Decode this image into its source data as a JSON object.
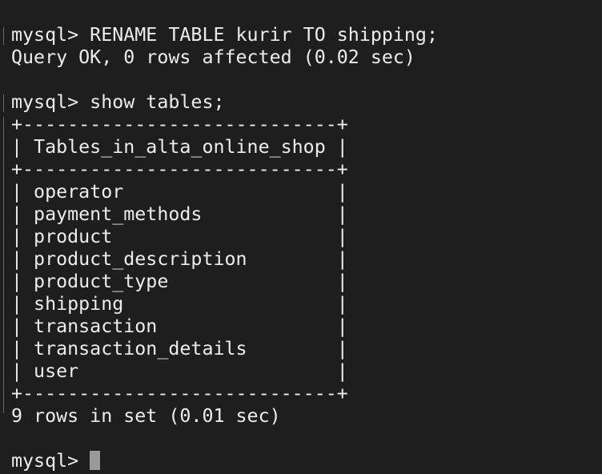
{
  "terminal": {
    "prompt": "mysql> ",
    "lines": {
      "cmd_rename": "mysql> RENAME TABLE kurir TO shipping;",
      "result_rename": "Query OK, 0 rows affected (0.02 sec)",
      "cmd_show": "mysql> show tables;",
      "table_border_top": "+----------------------------+",
      "table_header": "| Tables_in_alta_online_shop |",
      "table_border_mid": "+----------------------------+",
      "rows": [
        "| operator                   |",
        "| payment_methods            |",
        "| product                    |",
        "| product_description        |",
        "| product_type               |",
        "| shipping                   |",
        "| transaction                |",
        "| transaction_details        |",
        "| user                       |"
      ],
      "table_border_bottom": "+----------------------------+",
      "result_show": "9 rows in set (0.01 sec)",
      "current_prompt": "mysql> "
    }
  }
}
